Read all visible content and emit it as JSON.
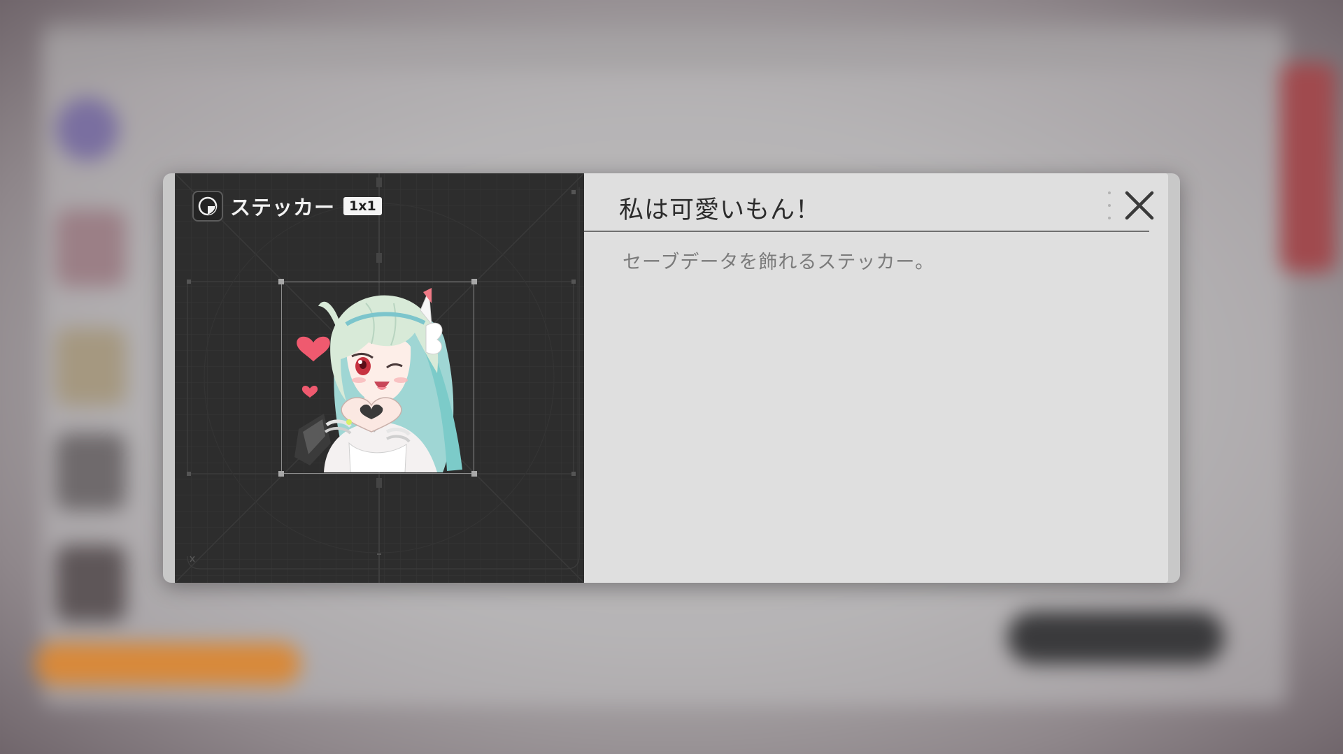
{
  "item_type": {
    "label": "ステッカー",
    "size_badge": "1x1",
    "icon": "sticker-icon"
  },
  "item": {
    "title": "私は可愛いもん！",
    "description": "セーブデータを飾れるステッカー。"
  },
  "controls": {
    "close_icon": "close-icon",
    "more_icon": "more-dots-icon"
  },
  "colors": {
    "preview_bg": "#2d2d2d",
    "info_bg": "#dfdfdf",
    "title_text": "#2c2c2c",
    "desc_text": "#7b7b7b",
    "heart": "#ef5a6f",
    "hair": "#d8ead8"
  }
}
